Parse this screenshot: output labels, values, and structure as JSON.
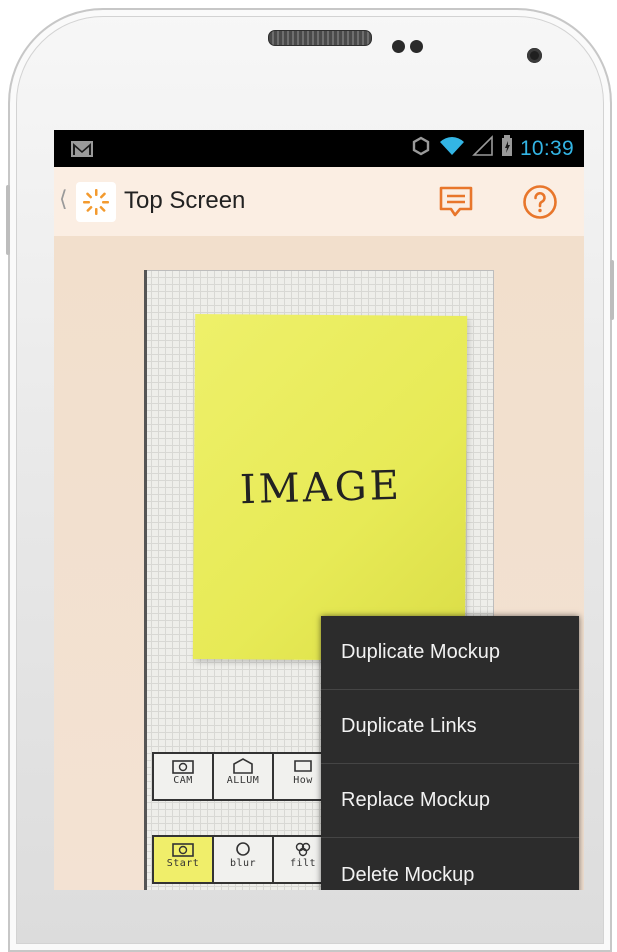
{
  "status_bar": {
    "notification_icon": "gmail-icon",
    "icons": [
      "sync-icon",
      "wifi-icon",
      "signal-icon",
      "battery-icon"
    ],
    "time": "10:39"
  },
  "action_bar": {
    "back_icon": "chevron-left-icon",
    "app_icon": "sunburst-logo-icon",
    "title": "Top Screen",
    "actions": [
      "comment-icon",
      "help-icon"
    ],
    "accent_color": "#e8762b"
  },
  "mockup": {
    "sticky_note_text": "IMAGE",
    "tab_row_1": [
      "CAM",
      "ALLUM",
      "How"
    ],
    "tab_row_2": [
      "Start",
      "blur",
      "filt"
    ]
  },
  "context_menu": {
    "items": [
      "Duplicate Mockup",
      "Duplicate Links",
      "Replace Mockup",
      "Delete Mockup"
    ]
  },
  "colors": {
    "status_bar_bg": "#000000",
    "status_text": "#33b5e5",
    "action_bar_bg": "#fbeee3",
    "content_bg": "#f2dfcc",
    "menu_bg": "#2c2c2c",
    "menu_text": "#f2f2f2"
  }
}
